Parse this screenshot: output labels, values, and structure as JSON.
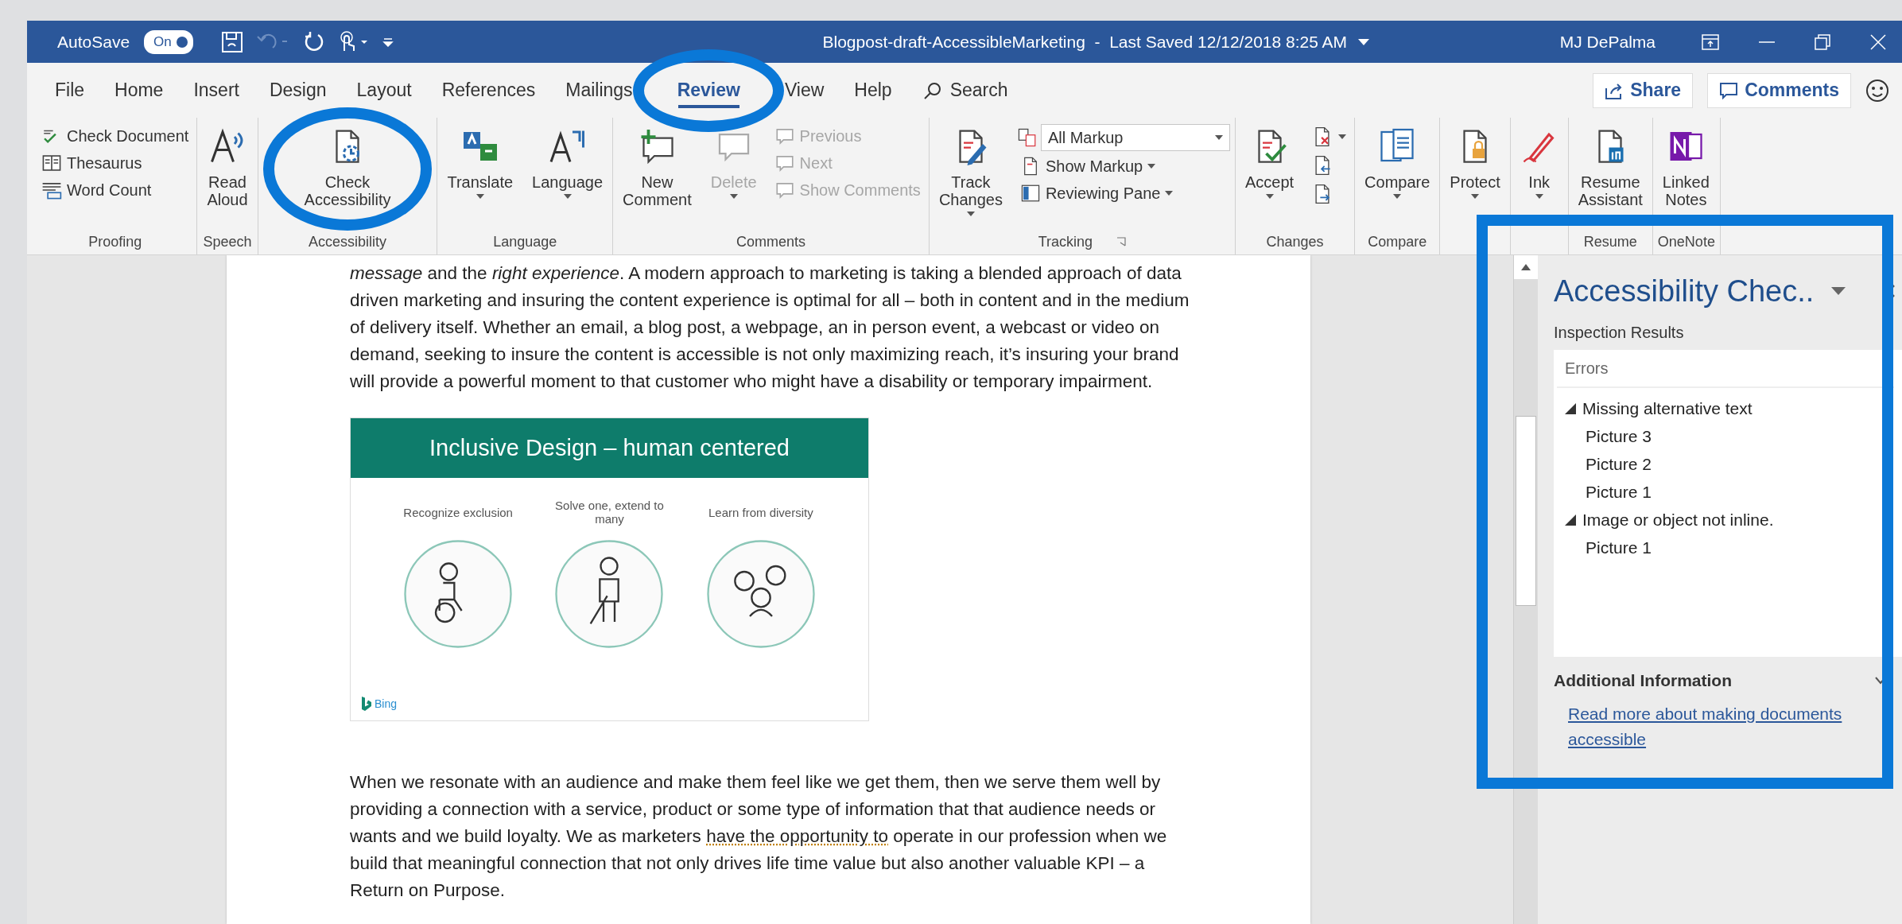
{
  "title_bar": {
    "autosave_label": "AutoSave",
    "autosave_toggle": {
      "label": "On",
      "on": true
    },
    "quick_access": [
      {
        "kind": "save",
        "disabled": false
      },
      {
        "kind": "undo",
        "disabled": true
      },
      {
        "kind": "redo",
        "disabled": false
      },
      {
        "kind": "touch",
        "disabled": false
      }
    ],
    "title": "Blogpost-draft-AccessibleMarketing  -  Last Saved 12/12/2018 8:25 AM",
    "user": "MJ DePalma"
  },
  "tabs": [
    {
      "label": "File",
      "selected": false
    },
    {
      "label": "Home",
      "selected": false
    },
    {
      "label": "Insert",
      "selected": false
    },
    {
      "label": "Design",
      "selected": false
    },
    {
      "label": "Layout",
      "selected": false
    },
    {
      "label": "References",
      "selected": false
    },
    {
      "label": "Mailings",
      "selected": false
    },
    {
      "label": "Review",
      "selected": true
    },
    {
      "label": "View",
      "selected": false
    },
    {
      "label": "Help",
      "selected": false
    }
  ],
  "search": {
    "label": "Search"
  },
  "share_button": "Share",
  "comments_button": "Comments",
  "ribbon_groups": [
    {
      "label": "Proofing",
      "items": [
        {
          "kind": "stack",
          "items": [
            {
              "kind": "small",
              "label": "Check Document",
              "disabled": false
            },
            {
              "kind": "small",
              "label": "Thesaurus",
              "disabled": false
            },
            {
              "kind": "small",
              "label": "Word Count",
              "disabled": false
            }
          ]
        }
      ]
    },
    {
      "label": "Speech",
      "items": [
        {
          "kind": "large",
          "label": "Read Aloud",
          "disabled": false
        }
      ]
    },
    {
      "label": "Accessibility",
      "items": [
        {
          "kind": "large",
          "label": "Check Accessibility",
          "disabled": false
        }
      ]
    },
    {
      "label": "Language",
      "items": [
        {
          "kind": "large",
          "label": "Translate",
          "dropdown": true,
          "disabled": false
        },
        {
          "kind": "large",
          "label": "Language",
          "dropdown": true,
          "disabled": false
        }
      ]
    },
    {
      "label": "Comments",
      "items": [
        {
          "kind": "large",
          "label": "New Comment",
          "disabled": false
        },
        {
          "kind": "large",
          "label": "Delete",
          "dropdown": true,
          "disabled": true
        },
        {
          "kind": "stack",
          "items": [
            {
              "kind": "small",
              "label": "Previous",
              "disabled": true
            },
            {
              "kind": "small",
              "label": "Next",
              "disabled": true
            },
            {
              "kind": "small",
              "label": "Show Comments",
              "disabled": true
            }
          ]
        }
      ]
    },
    {
      "label": "Tracking",
      "launcher": true,
      "items": [
        {
          "kind": "large",
          "label": "Track Changes",
          "dropdown": true,
          "disabled": false
        },
        {
          "kind": "stack",
          "items": [
            {
              "kind": "select",
              "label": "All Markup",
              "disabled": false
            },
            {
              "kind": "small",
              "label": "Show Markup",
              "dropdown": true,
              "disabled": false
            },
            {
              "kind": "small",
              "label": "Reviewing Pane",
              "dropdown": true,
              "disabled": false
            }
          ]
        }
      ]
    },
    {
      "label": "Changes",
      "items": [
        {
          "kind": "large",
          "label": "Accept",
          "dropdown": true,
          "disabled": false
        },
        {
          "kind": "stack",
          "items": [
            {
              "kind": "icon",
              "dropdown": true,
              "disabled": false
            },
            {
              "kind": "icon",
              "disabled": false
            },
            {
              "kind": "icon",
              "disabled": false
            }
          ]
        }
      ]
    },
    {
      "label": "Compare",
      "items": [
        {
          "kind": "large",
          "label": "Compare",
          "dropdown": true,
          "disabled": false
        }
      ]
    },
    {
      "items": [
        {
          "kind": "large",
          "label": "Protect",
          "dropdown": true,
          "disabled": false
        }
      ]
    },
    {
      "items": [
        {
          "kind": "large",
          "label": "Ink",
          "dropdown": true,
          "disabled": false
        }
      ]
    },
    {
      "label": "Resume",
      "items": [
        {
          "kind": "large",
          "label": "Resume Assistant",
          "disabled": false
        }
      ]
    },
    {
      "label": "OneNote",
      "items": [
        {
          "kind": "large",
          "label": "Linked Notes",
          "disabled": false
        }
      ]
    }
  ],
  "document": {
    "blocks": [
      {
        "kind": "paragraph",
        "text": "*message* and the *right experience*. A modern approach to marketing is taking a blended approach of data driven marketing and insuring the content experience is optimal for all – both in content and in the medium of delivery itself. Whether an email, a blog post, a webpage, an in person event, a webcast or video on demand, seeking to insure the content is accessible is not only maximizing reach, it’s insuring your brand will provide a powerful moment to that customer who might have a disability or temporary impairment."
      },
      {
        "kind": "figure",
        "title": "Inclusive Design – human centered",
        "panels": [
          {
            "caption": "Recognize exclusion",
            "kind": "wheelchair"
          },
          {
            "caption": "Solve one, extend to many",
            "kind": "cane"
          },
          {
            "caption": "Learn from diversity",
            "kind": "group"
          }
        ],
        "brand": "Bing"
      },
      {
        "kind": "paragraph",
        "segments": [
          {
            "text": "When we resonate with an audience and make them feel like we get them, then we serve them well by providing a connection with a service, product or some type of information that that audience needs or wants and we build loyalty. We as marketers ",
            "flagged": false
          },
          {
            "text": "have the opportunity to",
            "flagged": true
          },
          {
            "text": " operate in our profession when we build that meaningful connection that not only drives life time value but also another valuable KPI – a Return on Purpose.",
            "flagged": false
          }
        ]
      }
    ]
  },
  "pane": {
    "title": "Accessibility Chec..",
    "section": "Inspection Results",
    "list_header": "Errors",
    "issues": [
      {
        "label": "Missing alternative text",
        "expanded": true,
        "children": [
          {
            "label": "Picture 3"
          },
          {
            "label": "Picture 2"
          },
          {
            "label": "Picture 1"
          }
        ]
      },
      {
        "label": "Image or object not inline.",
        "expanded": true,
        "children": [
          {
            "label": "Picture 1"
          }
        ]
      }
    ],
    "additional_heading": "Additional Information",
    "link": "Read more about making documents accessible"
  }
}
